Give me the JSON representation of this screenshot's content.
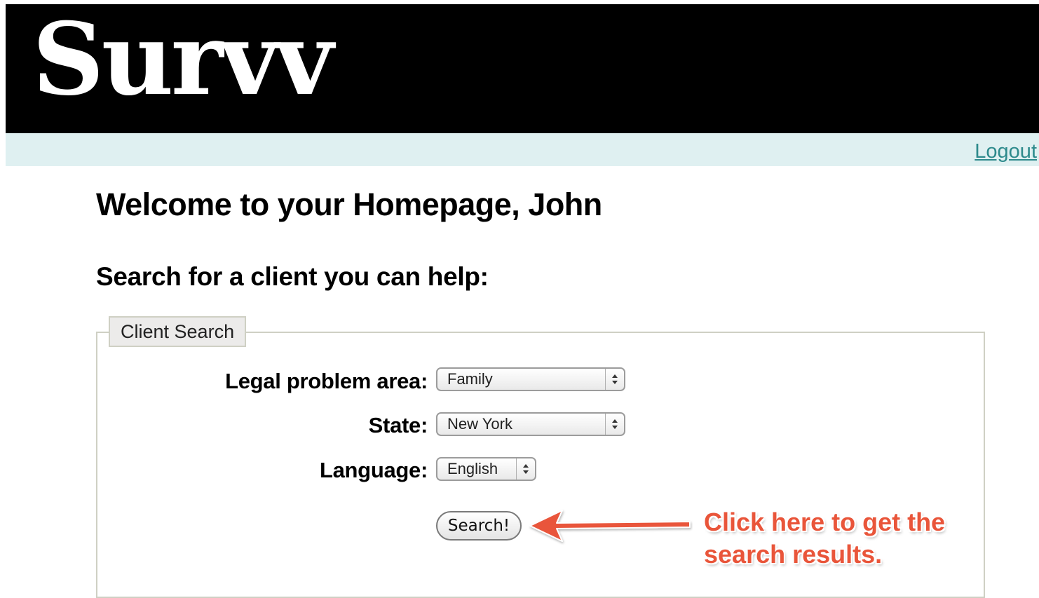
{
  "app": {
    "logo_text": "Survv"
  },
  "nav": {
    "logout_label": "Logout"
  },
  "page": {
    "welcome_title": "Welcome to your Homepage, John",
    "search_heading": "Search for a client you can help:"
  },
  "client_search": {
    "legend": "Client Search",
    "fields": {
      "legal_problem_area": {
        "label": "Legal problem area:",
        "value": "Family"
      },
      "state": {
        "label": "State:",
        "value": "New York"
      },
      "language": {
        "label": "Language:",
        "value": "English"
      }
    },
    "search_button_label": "Search!"
  },
  "annotation": {
    "text_line1": "Click here to get the",
    "text_line2": "search results.",
    "color": "#e9553a"
  },
  "colors": {
    "header_bg": "#000000",
    "navbar_bg": "#dff0f1",
    "link": "#2d8a8c"
  },
  "icons": {
    "select_arrows": "up-down-chevron-icon",
    "annotation_arrow": "arrow-left-icon"
  }
}
